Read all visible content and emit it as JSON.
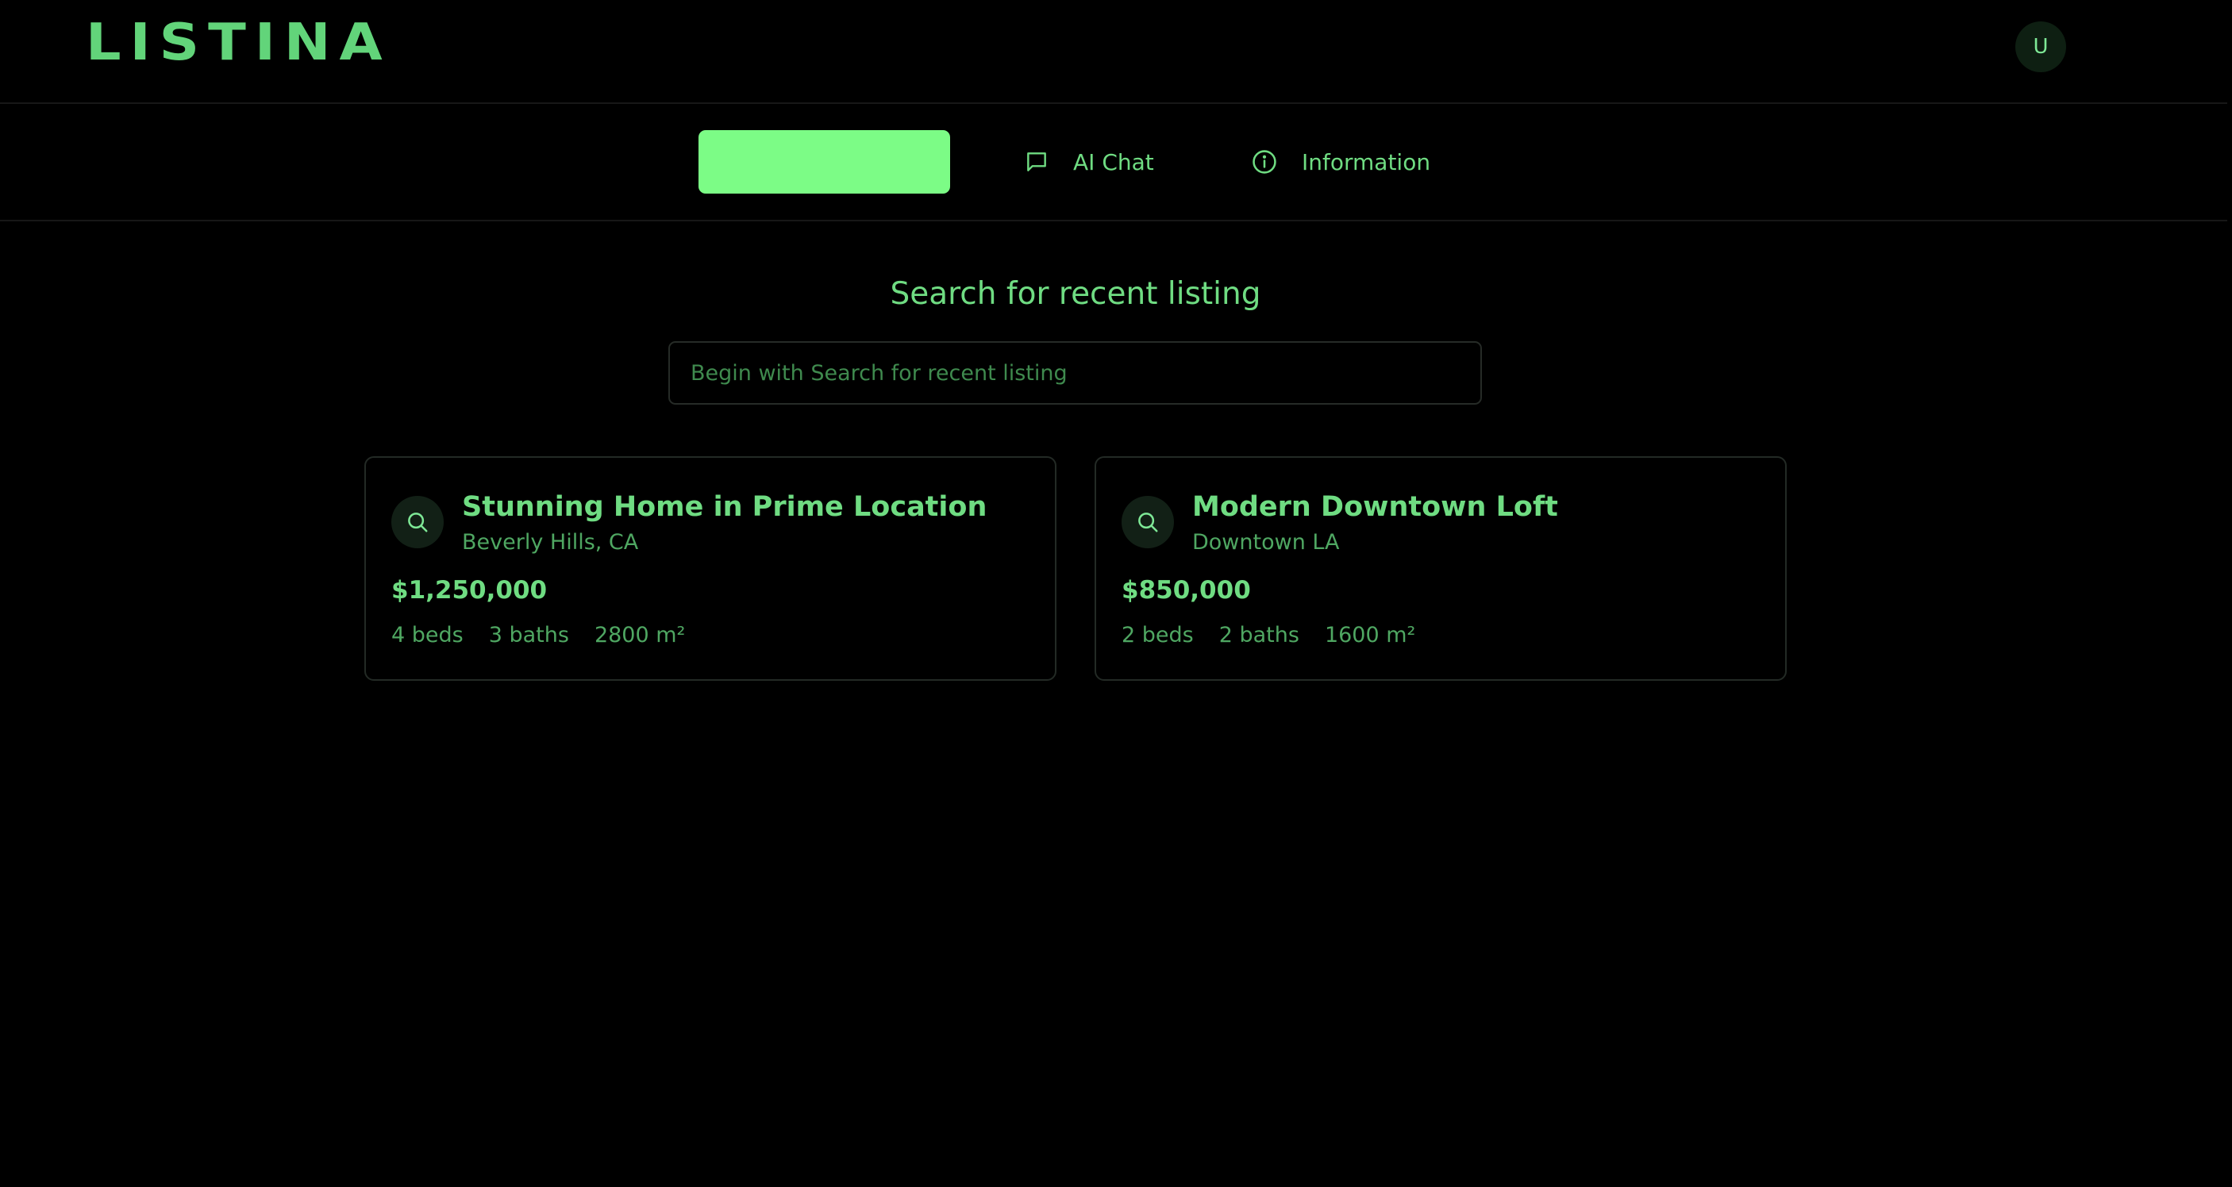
{
  "app": {
    "logo_text": "LISTINA",
    "avatar_initial": "U"
  },
  "nav": {
    "active_label": "",
    "chat_label": "AI Chat",
    "info_label": "Information"
  },
  "search": {
    "title": "Search for recent listing",
    "placeholder": "Begin with Search for recent listing",
    "value": ""
  },
  "listings": [
    {
      "title": "Stunning Home in Prime Location",
      "location": "Beverly Hills, CA",
      "price": "$1,250,000",
      "beds": "4 beds",
      "baths": "3 baths",
      "area": "2800 m²"
    },
    {
      "title": "Modern Downtown Loft",
      "location": "Downtown LA",
      "price": "$850,000",
      "beds": "2 beds",
      "baths": "2 baths",
      "area": "1600 m²"
    }
  ],
  "colors": {
    "background": "#000000",
    "accent": "#7cfc86",
    "text": "#6fdc82",
    "muted_text": "#4fa762",
    "border": "#232a25"
  }
}
